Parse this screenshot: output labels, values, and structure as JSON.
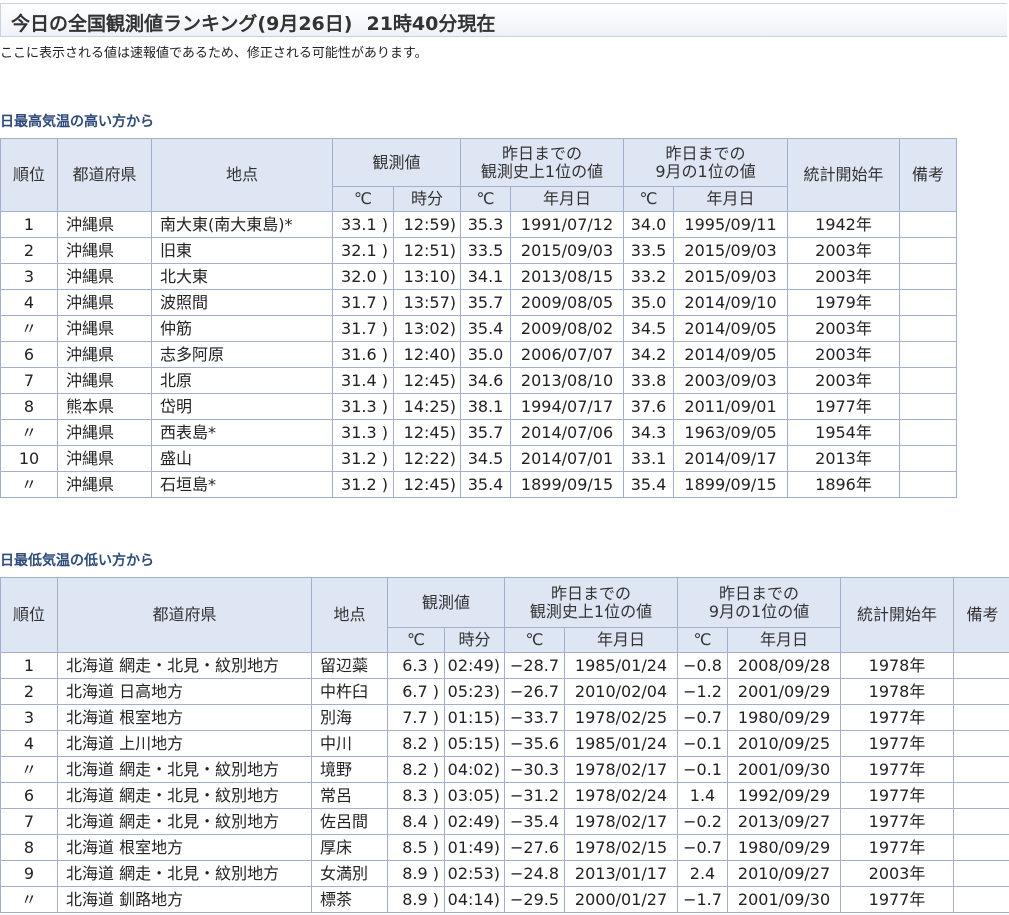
{
  "page": {
    "title": "今日の全国観測値ランキング(9月26日)",
    "timestamp": "21時40分現在",
    "note": "ここに表示される値は速報値であるため、修正される可能性があります。"
  },
  "headers": {
    "rank": "順位",
    "pref": "都道府県",
    "station": "地点",
    "obs": "観測値",
    "record_all_1": "昨日までの",
    "record_all_2": "観測史上1位の値",
    "record_month_1": "昨日までの",
    "record_month_2": "9月の1位の値",
    "start": "統計開始年",
    "remarks": "備考",
    "deg": "℃",
    "time": "時分",
    "date": "年月日"
  },
  "high": {
    "title": "日最高気温の高い方から",
    "rows": [
      {
        "rank": "1",
        "pref": "沖縄県",
        "station": "南大東(南大東島)*",
        "temp": "33.1 )",
        "time": "12:59)",
        "rec_temp": "35.3",
        "rec_date": "1991/07/12",
        "mon_temp": "34.0",
        "mon_date": "1995/09/11",
        "start": "1942年",
        "note": ""
      },
      {
        "rank": "2",
        "pref": "沖縄県",
        "station": "旧東",
        "temp": "32.1 )",
        "time": "12:51)",
        "rec_temp": "33.5",
        "rec_date": "2015/09/03",
        "mon_temp": "33.5",
        "mon_date": "2015/09/03",
        "start": "2003年",
        "note": ""
      },
      {
        "rank": "3",
        "pref": "沖縄県",
        "station": "北大東",
        "temp": "32.0 )",
        "time": "13:10)",
        "rec_temp": "34.1",
        "rec_date": "2013/08/15",
        "mon_temp": "33.2",
        "mon_date": "2015/09/03",
        "start": "2003年",
        "note": ""
      },
      {
        "rank": "4",
        "pref": "沖縄県",
        "station": "波照間",
        "temp": "31.7 )",
        "time": "13:57)",
        "rec_temp": "35.7",
        "rec_date": "2009/08/05",
        "mon_temp": "35.0",
        "mon_date": "2014/09/10",
        "start": "1979年",
        "note": ""
      },
      {
        "rank": "〃",
        "pref": "沖縄県",
        "station": "仲筋",
        "temp": "31.7 )",
        "time": "13:02)",
        "rec_temp": "35.4",
        "rec_date": "2009/08/02",
        "mon_temp": "34.5",
        "mon_date": "2014/09/05",
        "start": "2003年",
        "note": ""
      },
      {
        "rank": "6",
        "pref": "沖縄県",
        "station": "志多阿原",
        "temp": "31.6 )",
        "time": "12:40)",
        "rec_temp": "35.0",
        "rec_date": "2006/07/07",
        "mon_temp": "34.2",
        "mon_date": "2014/09/05",
        "start": "2003年",
        "note": ""
      },
      {
        "rank": "7",
        "pref": "沖縄県",
        "station": "北原",
        "temp": "31.4 )",
        "time": "12:45)",
        "rec_temp": "34.6",
        "rec_date": "2013/08/10",
        "mon_temp": "33.8",
        "mon_date": "2003/09/03",
        "start": "2003年",
        "note": ""
      },
      {
        "rank": "8",
        "pref": "熊本県",
        "station": "岱明",
        "temp": "31.3 )",
        "time": "14:25)",
        "rec_temp": "38.1",
        "rec_date": "1994/07/17",
        "mon_temp": "37.6",
        "mon_date": "2011/09/01",
        "start": "1977年",
        "note": ""
      },
      {
        "rank": "〃",
        "pref": "沖縄県",
        "station": "西表島*",
        "temp": "31.3 )",
        "time": "12:45)",
        "rec_temp": "35.7",
        "rec_date": "2014/07/06",
        "mon_temp": "34.3",
        "mon_date": "1963/09/05",
        "start": "1954年",
        "note": ""
      },
      {
        "rank": "10",
        "pref": "沖縄県",
        "station": "盛山",
        "temp": "31.2 )",
        "time": "12:22)",
        "rec_temp": "34.5",
        "rec_date": "2014/07/01",
        "mon_temp": "33.1",
        "mon_date": "2014/09/17",
        "start": "2013年",
        "note": ""
      },
      {
        "rank": "〃",
        "pref": "沖縄県",
        "station": "石垣島*",
        "temp": "31.2 )",
        "time": "12:45)",
        "rec_temp": "35.4",
        "rec_date": "1899/09/15",
        "mon_temp": "35.4",
        "mon_date": "1899/09/15",
        "start": "1896年",
        "note": ""
      }
    ]
  },
  "low": {
    "title": "日最低気温の低い方から",
    "rows": [
      {
        "rank": "1",
        "pref": "北海道 網走・北見・紋別地方",
        "station": "留辺蘂",
        "temp": "6.3 )",
        "time": "02:49)",
        "rec_temp": "−28.7",
        "rec_date": "1985/01/24",
        "mon_temp": "−0.8",
        "mon_date": "2008/09/28",
        "start": "1978年",
        "note": ""
      },
      {
        "rank": "2",
        "pref": "北海道 日高地方",
        "station": "中杵臼",
        "temp": "6.7 )",
        "time": "05:23)",
        "rec_temp": "−26.7",
        "rec_date": "2010/02/04",
        "mon_temp": "−1.2",
        "mon_date": "2001/09/29",
        "start": "1978年",
        "note": ""
      },
      {
        "rank": "3",
        "pref": "北海道 根室地方",
        "station": "別海",
        "temp": "7.7 )",
        "time": "01:15)",
        "rec_temp": "−33.7",
        "rec_date": "1978/02/25",
        "mon_temp": "−0.7",
        "mon_date": "1980/09/29",
        "start": "1977年",
        "note": ""
      },
      {
        "rank": "4",
        "pref": "北海道 上川地方",
        "station": "中川",
        "temp": "8.2 )",
        "time": "05:15)",
        "rec_temp": "−35.6",
        "rec_date": "1985/01/24",
        "mon_temp": "−0.1",
        "mon_date": "2010/09/25",
        "start": "1977年",
        "note": ""
      },
      {
        "rank": "〃",
        "pref": "北海道 網走・北見・紋別地方",
        "station": "境野",
        "temp": "8.2 )",
        "time": "04:02)",
        "rec_temp": "−30.3",
        "rec_date": "1978/02/17",
        "mon_temp": "−0.1",
        "mon_date": "2001/09/30",
        "start": "1977年",
        "note": ""
      },
      {
        "rank": "6",
        "pref": "北海道 網走・北見・紋別地方",
        "station": "常呂",
        "temp": "8.3 )",
        "time": "03:05)",
        "rec_temp": "−31.2",
        "rec_date": "1978/02/24",
        "mon_temp": "1.4",
        "mon_date": "1992/09/29",
        "start": "1977年",
        "note": ""
      },
      {
        "rank": "7",
        "pref": "北海道 網走・北見・紋別地方",
        "station": "佐呂間",
        "temp": "8.4 )",
        "time": "02:49)",
        "rec_temp": "−35.4",
        "rec_date": "1978/02/17",
        "mon_temp": "−0.2",
        "mon_date": "2013/09/27",
        "start": "1977年",
        "note": ""
      },
      {
        "rank": "8",
        "pref": "北海道 根室地方",
        "station": "厚床",
        "temp": "8.5 )",
        "time": "01:49)",
        "rec_temp": "−27.6",
        "rec_date": "1978/02/15",
        "mon_temp": "−0.7",
        "mon_date": "1980/09/29",
        "start": "1977年",
        "note": ""
      },
      {
        "rank": "9",
        "pref": "北海道 網走・北見・紋別地方",
        "station": "女満別",
        "temp": "8.9 )",
        "time": "02:53)",
        "rec_temp": "−24.8",
        "rec_date": "2013/01/17",
        "mon_temp": "2.4",
        "mon_date": "2010/09/27",
        "start": "2003年",
        "note": ""
      },
      {
        "rank": "〃",
        "pref": "北海道 釧路地方",
        "station": "標茶",
        "temp": "8.9 )",
        "time": "04:14)",
        "rec_temp": "−29.5",
        "rec_date": "2000/01/27",
        "mon_temp": "−1.7",
        "mon_date": "2001/09/30",
        "start": "1977年",
        "note": ""
      }
    ]
  }
}
